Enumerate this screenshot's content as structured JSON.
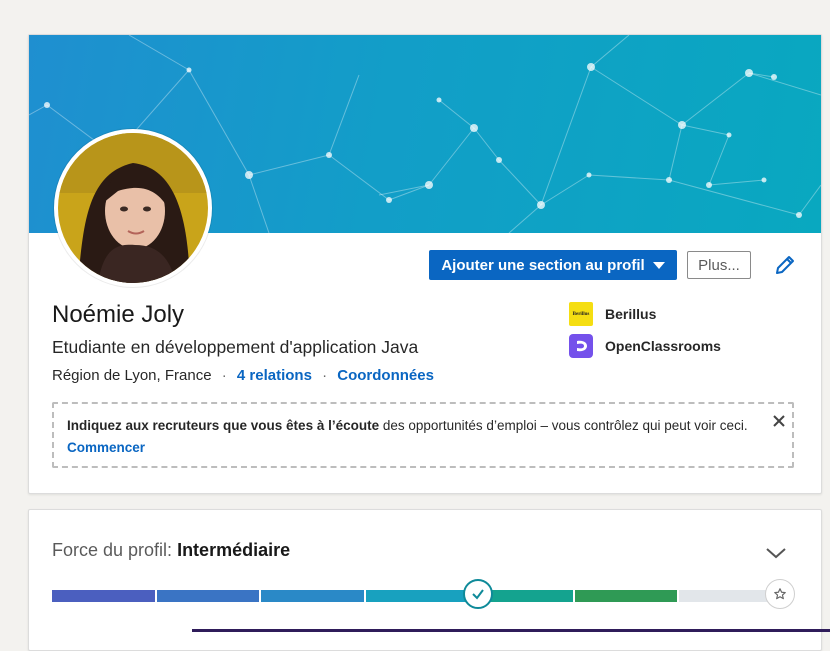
{
  "profile": {
    "name": "Noémie Joly",
    "headline": "Etudiante en développement d'application Java",
    "location": "Région de Lyon, France",
    "separator": "·",
    "relations_link": "4 relations",
    "contact_link": "Coordonnées"
  },
  "actions": {
    "add_section_label": "Ajouter une section au profil",
    "more_label": "Plus..."
  },
  "companies": [
    {
      "name": "Berillus",
      "logo_text": "Berillus",
      "logo_color": "#f5de12"
    },
    {
      "name": "OpenClassrooms",
      "logo_color": "#7451eb"
    }
  ],
  "open_to_work": {
    "bold_text": "Indiquez aux recruteurs que vous êtes à l’écoute",
    "rest_text": " des opportunités d’emploi – vous contrôlez qui peut voir ceci.",
    "link": "Commencer"
  },
  "profile_strength": {
    "label": "Force du profil: ",
    "level": "Intermédiaire",
    "current_step": 4,
    "total_steps": 7
  },
  "colors": {
    "primary": "#0a66c2",
    "meter_segments": [
      "#4b5fbf",
      "#3a74c4",
      "#2a89c7",
      "#18a1bf",
      "#14a38f",
      "#2f9a55",
      "#e2e6ea"
    ]
  }
}
